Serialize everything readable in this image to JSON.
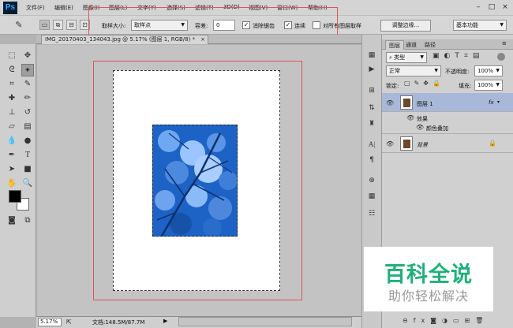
{
  "app": {
    "logo": "Ps"
  },
  "menu": [
    "文件(F)",
    "编辑(E)",
    "图像(I)",
    "图层(L)",
    "文字(Y)",
    "选择(S)",
    "滤镜(T)",
    "3D(D)",
    "视图(V)",
    "窗口(W)",
    "帮助(H)"
  ],
  "window_controls": {
    "minimize": "–",
    "maximize": "□",
    "close": "×"
  },
  "options": {
    "sample_size_label": "取样大小:",
    "sample_size_value": "取样点",
    "tolerance_label": "容差:",
    "tolerance_value": "0",
    "antialias_label": "消除锯齿",
    "antialias_checked": true,
    "contiguous_label": "连续",
    "contiguous_checked": true,
    "all_layers_label": "对所有图层取样",
    "all_layers_checked": false,
    "refine_edge_label": "调整边缘...",
    "workspace_value": "基本功能"
  },
  "document": {
    "tab_title": "IMG_20170403_134043.jpg @ 5.17% (图层 1, RGB/8) *",
    "close": "×"
  },
  "status": {
    "zoom": "5.17%",
    "doc_info": "文档:148.5M/87.7M"
  },
  "panel": {
    "tabs": [
      "图层",
      "通道",
      "路径"
    ],
    "kind_value": "类型",
    "blend_mode": "正常",
    "opacity_label": "不透明度:",
    "opacity_value": "100%",
    "lock_label": "锁定:",
    "fill_label": "填充:",
    "fill_value": "100%",
    "layers": [
      {
        "name": "图层 1",
        "fx": "fx",
        "selected": true
      },
      {
        "name": "背景",
        "locked": true
      }
    ],
    "effects_label": "效果",
    "color_overlay_label": "颜色叠加"
  },
  "watermark": {
    "title": "百科全说",
    "subtitle": "助你轻松解决"
  },
  "colors": {
    "accent_green": "#1db17a",
    "photo_blue": "#1c63c4",
    "highlight_box": "#e05555",
    "selected_layer": "#a9b8d8"
  }
}
